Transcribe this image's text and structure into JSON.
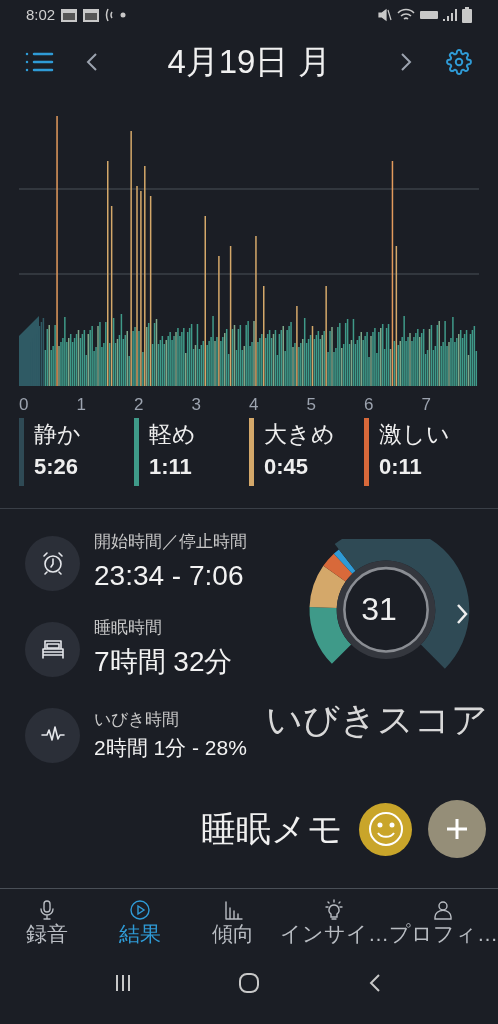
{
  "status_bar": {
    "time": "8:02"
  },
  "header": {
    "date": "4月19日 月"
  },
  "chart": {
    "x_ticks": [
      "0",
      "1",
      "2",
      "3",
      "4",
      "5",
      "6",
      "7"
    ]
  },
  "legend": [
    {
      "label": "静か",
      "value": "5:26",
      "color": "#2f4a55"
    },
    {
      "label": "軽め",
      "value": "1:11",
      "color": "#3f9a89"
    },
    {
      "label": "大きめ",
      "value": "0:45",
      "color": "#d4a86a"
    },
    {
      "label": "激しい",
      "value": "0:11",
      "color": "#d8693a"
    }
  ],
  "stats": [
    {
      "kind": "alarm",
      "label": "開始時間／停止時間",
      "value": "23:34 - 7:06"
    },
    {
      "kind": "bed",
      "label": "睡眠時間",
      "value": "7時間 32分"
    },
    {
      "kind": "pulse",
      "label": "いびき時間",
      "value": "2時間 1分 - 28%"
    }
  ],
  "score": {
    "value": "31",
    "label": "いびきスコア"
  },
  "memo": {
    "label": "睡眠メモ"
  },
  "nav": [
    {
      "kind": "mic",
      "label": "録音",
      "selected": false
    },
    {
      "kind": "play",
      "label": "結果",
      "selected": true
    },
    {
      "kind": "bars",
      "label": "傾向",
      "selected": false
    },
    {
      "kind": "bulb",
      "label": "インサイ…",
      "selected": false
    },
    {
      "kind": "person",
      "label": "プロフィ…",
      "selected": false
    }
  ]
}
